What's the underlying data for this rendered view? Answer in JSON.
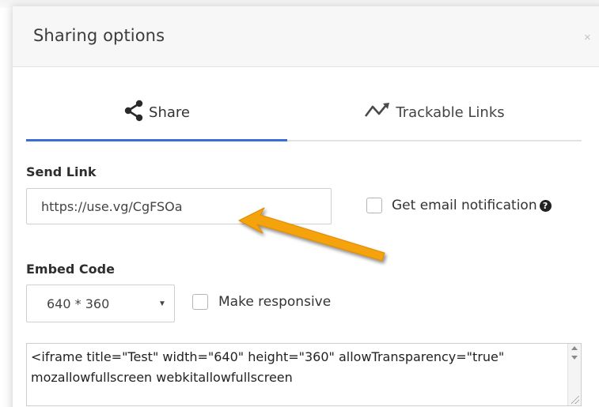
{
  "modal": {
    "title": "Sharing options",
    "close_label": "×"
  },
  "tabs": [
    {
      "label": "Share",
      "icon": "share-icon",
      "active": true
    },
    {
      "label": "Trackable Links",
      "icon": "trend-line-icon",
      "active": false
    }
  ],
  "send_link": {
    "label": "Send Link",
    "value": "https://use.vg/CgFSOa",
    "email_notification_label": "Get email notification",
    "help_icon": "?"
  },
  "embed": {
    "label": "Embed Code",
    "size_selected": "640 * 360",
    "responsive_label": "Make responsive",
    "code": "<iframe title=\"Test\" width=\"640\" height=\"360\" allowTransparency=\"true\" mozallowfullscreen webkitallowfullscreen"
  },
  "colors": {
    "active_tab": "#3a6dd8",
    "annotation_arrow": "#f5a30c"
  }
}
